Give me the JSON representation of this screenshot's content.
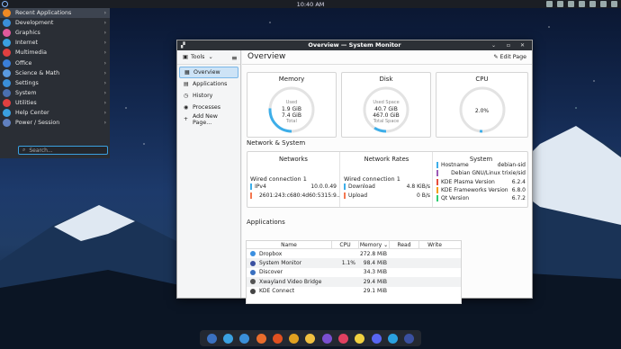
{
  "top_panel": {
    "clock": "10:40 AM"
  },
  "app_menu": {
    "items": [
      {
        "label": "Recent Applications",
        "color": "#f08a24"
      },
      {
        "label": "Development",
        "color": "#3a8fd9"
      },
      {
        "label": "Graphics",
        "color": "#e05a9c"
      },
      {
        "label": "Internet",
        "color": "#3aa0e0"
      },
      {
        "label": "Multimedia",
        "color": "#e04040"
      },
      {
        "label": "Office",
        "color": "#3a7fd9"
      },
      {
        "label": "Science & Math",
        "color": "#5a9ae0"
      },
      {
        "label": "Settings",
        "color": "#3a8fd9"
      },
      {
        "label": "System",
        "color": "#4a70b0"
      },
      {
        "label": "Utilities",
        "color": "#e04040"
      },
      {
        "label": "Help Center",
        "color": "#3aa0e0"
      },
      {
        "label": "Power / Session",
        "color": "#6080c0"
      }
    ],
    "search_placeholder": "Search..."
  },
  "window": {
    "title": "Overview — System Monitor",
    "sidebar": {
      "tools_label": "Tools",
      "items": [
        {
          "label": "Overview"
        },
        {
          "label": "Applications"
        },
        {
          "label": "History"
        },
        {
          "label": "Processes"
        },
        {
          "label": "Add New Page..."
        }
      ]
    },
    "header": {
      "title": "Overview",
      "edit_label": "Edit Page"
    },
    "memory": {
      "title": "Memory",
      "used_label": "Used",
      "used": "1.9 GiB",
      "total": "7.4 GiB",
      "total_label": "Total",
      "fraction": 0.26
    },
    "disk": {
      "title": "Disk",
      "used_label": "Used Space",
      "used": "40.7 GiB",
      "total": "467.0 GiB",
      "total_label": "Total Space",
      "fraction": 0.09
    },
    "cpu": {
      "title": "CPU",
      "value": "2.0%",
      "fraction": 0.02
    },
    "network_system_title": "Network & System",
    "networks": {
      "title": "Networks",
      "conn": "Wired connection 1",
      "ipv4_label": "IPv4",
      "ipv4": "10.0.0.49",
      "ipv6": "2601:243:c680:4d60:5315:9..."
    },
    "rates": {
      "title": "Network Rates",
      "conn": "Wired connection 1",
      "download_label": "Download",
      "download": "4.8 KiB/s",
      "upload_label": "Upload",
      "upload": "0 B/s"
    },
    "system": {
      "title": "System",
      "rows": [
        {
          "k": "Hostname",
          "v": "debian-sid",
          "color": "#3daee9"
        },
        {
          "k": "",
          "v": "Debian GNU/Linux trixie/sid",
          "color": "#9b59b6"
        },
        {
          "k": "KDE Plasma Version",
          "v": "6.2.4",
          "color": "#e74c3c"
        },
        {
          "k": "KDE Frameworks Version",
          "v": "6.8.0",
          "color": "#f39c12"
        },
        {
          "k": "Qt Version",
          "v": "6.7.2",
          "color": "#2ecc71"
        }
      ]
    },
    "applications": {
      "title": "Applications",
      "columns": [
        "Name",
        "CPU",
        "Memory",
        "Read",
        "Write"
      ],
      "rows": [
        {
          "name": "Dropbox",
          "cpu": "",
          "mem": "272.8 MiB",
          "color": "#3a8fe0"
        },
        {
          "name": "System Monitor",
          "cpu": "1.1%",
          "mem": "98.4 MiB",
          "color": "#3a50a0"
        },
        {
          "name": "Discover",
          "cpu": "",
          "mem": "34.3 MiB",
          "color": "#3a70c0"
        },
        {
          "name": "Xwayland Video Bridge",
          "cpu": "",
          "mem": "29.4 MiB",
          "color": "#555"
        },
        {
          "name": "KDE Connect",
          "cpu": "",
          "mem": "29.1 MiB",
          "color": "#444"
        }
      ]
    }
  },
  "dock": {
    "icons": [
      {
        "name": "files-icon",
        "color": "#3a70c0"
      },
      {
        "name": "discover-icon",
        "color": "#3aa0e0"
      },
      {
        "name": "settings-icon",
        "color": "#3a8fd9"
      },
      {
        "name": "browser-icon",
        "color": "#e86c2c"
      },
      {
        "name": "firefox-icon",
        "color": "#e05020"
      },
      {
        "name": "chrome-icon",
        "color": "#e0a020"
      },
      {
        "name": "email-icon",
        "color": "#f0c040"
      },
      {
        "name": "terminal-icon",
        "color": "#7a4fd0"
      },
      {
        "name": "chat-icon",
        "color": "#e04060"
      },
      {
        "name": "notes-icon",
        "color": "#f0d040"
      },
      {
        "name": "discord-icon",
        "color": "#5865f2"
      },
      {
        "name": "telegram-icon",
        "color": "#2aa0e0"
      },
      {
        "name": "monitor-icon",
        "color": "#3a50a0"
      }
    ]
  }
}
